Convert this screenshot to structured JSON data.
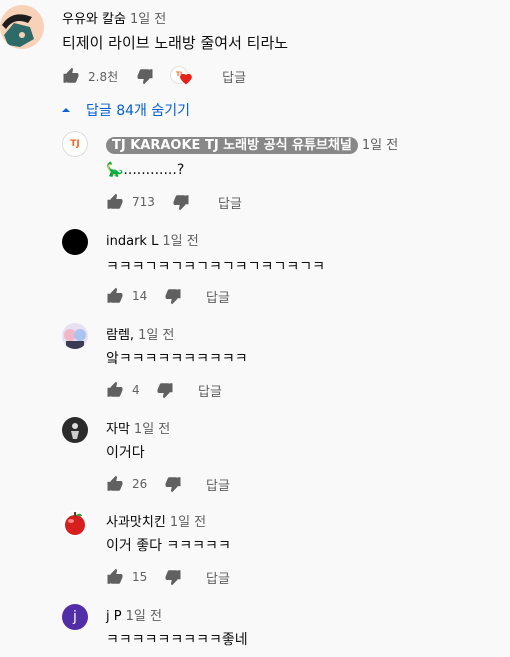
{
  "top_comment": {
    "author": "우유와 칼숨",
    "time": "1일 전",
    "text": "티제이 라이브 노래방 줄여서 티라노",
    "likes": "2.8천",
    "reply_label": "답글",
    "heart_badge": "TJ"
  },
  "replies_toggle": {
    "label": "답글 84개 숨기기"
  },
  "replies": [
    {
      "author": "TJ KARAOKE TJ 노래방 공식 유튜브채널",
      "time": "1일 전",
      "text": "🦕............?",
      "likes": "713",
      "reply_label": "답글",
      "avatar_text": "TJ"
    },
    {
      "author": "indark L",
      "time": "1일 전",
      "text": "ㅋㅋㅋㄱㅋㄱㅋㄱㅋㄱㅋㄱㅋㄱㅋㄱㅋ",
      "likes": "14",
      "reply_label": "답글"
    },
    {
      "author": "람렘,",
      "time": "1일 전",
      "text": "앜ㅋㅋㅋㅋㅋㅋㅋㅋㅋㅋ",
      "likes": "4",
      "reply_label": "답글"
    },
    {
      "author": "자막",
      "time": "1일 전",
      "text": "이거다",
      "likes": "26",
      "reply_label": "답글"
    },
    {
      "author": "사과맛치킨",
      "time": "1일 전",
      "text": "이거 좋다 ㅋㅋㅋㅋㅋ",
      "likes": "15",
      "reply_label": "답글"
    },
    {
      "author": "j P",
      "time": "1일 전",
      "text": "ㅋㅋㅋㅋㅋㅋㅋㅋㅋ좋네",
      "avatar_text": "j"
    }
  ],
  "colors": {
    "accent": "#065fd4",
    "heart": "#e62117",
    "tj_orange": "#f26522",
    "purple": "#512da8"
  }
}
